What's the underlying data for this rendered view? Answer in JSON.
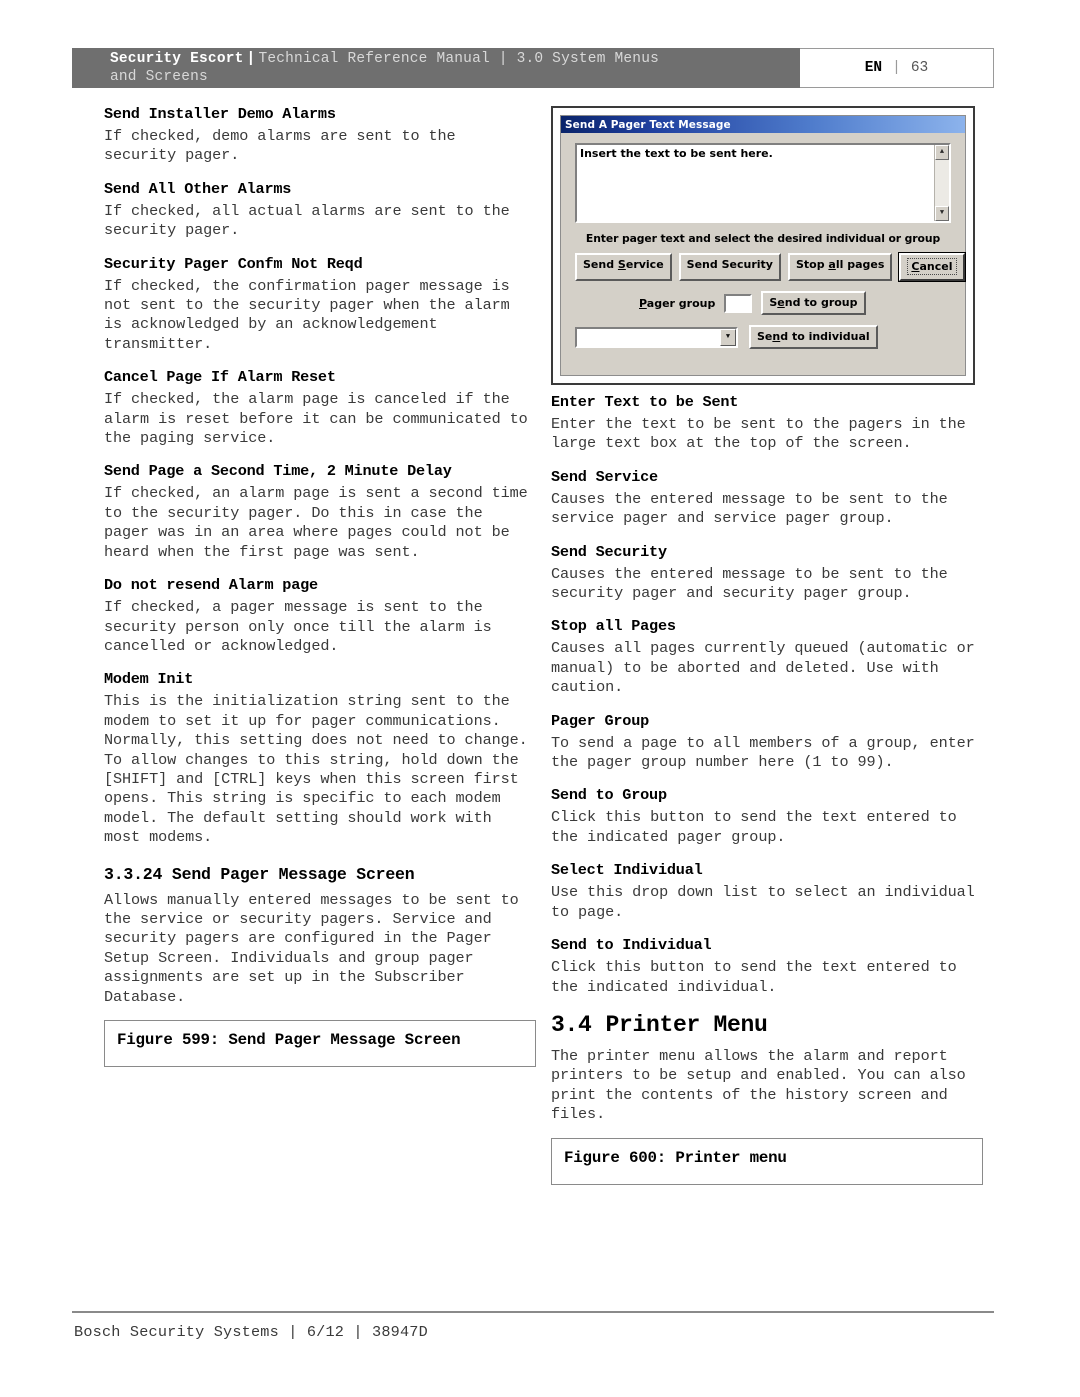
{
  "header": {
    "brand": "Security Escort",
    "sep": "|",
    "manual": "Technical Reference Manual",
    "section": "3.0  System Menus and Screens",
    "line1": "Technical Reference Manual | 3.0  System Menus",
    "line2": "and Screens",
    "language": "EN",
    "page_sep": "|",
    "page_number": "63"
  },
  "left_column": {
    "entries": [
      {
        "term": "Send Installer Demo Alarms",
        "body": "If checked, demo alarms are sent to the security pager."
      },
      {
        "term": "Send All Other Alarms",
        "body": "If checked, all actual alarms are sent to the security pager."
      },
      {
        "term": "Security Pager Confm Not Reqd",
        "body": "If checked, the confirmation pager message is not sent to the security pager when the alarm is acknowledged by an acknowledgement transmitter."
      },
      {
        "term": "Cancel Page If Alarm Reset",
        "body": "If checked, the alarm page is canceled if the alarm is reset before it can be communicated to the paging service."
      },
      {
        "term": "Send Page a Second Time, 2 Minute Delay",
        "body": "If checked, an alarm page is sent a second time to the security pager. Do this in case the pager was in an area where pages could not be heard when the first page was sent."
      },
      {
        "term": "Do not resend Alarm page",
        "body": "If checked, a pager message is sent to the security person only once till the alarm is cancelled or acknowledged."
      },
      {
        "term": "Modem Init",
        "body": "This is the initialization string sent to the modem to set it up for pager communications. Normally, this setting does not need to change. To allow changes to this string, hold down the [SHIFT] and [CTRL] keys when this screen first opens. This string is specific to each modem model. The default setting should work with most modems."
      }
    ],
    "section_heading": "3.3.24 Send Pager Message Screen",
    "section_body": "Allows manually entered messages to be sent to the service or security pagers. Service and security pagers are configured in the Pager Setup Screen. Individuals and group pager assignments are set up in the Subscriber Database.",
    "figure_caption": "Figure 599: Send Pager Message Screen"
  },
  "dialog": {
    "title": "Send A Pager Text Message",
    "message_text": "Insert the text to be sent here.",
    "hint": "Enter pager text and select the desired individual or group",
    "scroll_up_icon": "scroll-up-arrow",
    "scroll_down_icon": "scroll-down-arrow",
    "dropdown_icon": "chevron-down-icon",
    "buttons": {
      "send_service": "Send Service",
      "send_service_pre": "Send ",
      "send_service_mnemonic": "S",
      "send_service_post": "ervice",
      "send_security": "Send Security",
      "stop_all_pages_pre": "Stop ",
      "stop_all_pages_mnemonic": "a",
      "stop_all_pages_post": "ll pages",
      "stop_all_pages": "Stop all pages",
      "cancel": "Cancel",
      "cancel_pre": "",
      "cancel_mnemonic": "C",
      "cancel_post": "ancel",
      "send_to_group_pre": "S",
      "send_to_group_mnemonic": "e",
      "send_to_group_post": "nd to group",
      "send_to_group": "Send to group",
      "send_to_individual_pre": "Se",
      "send_to_individual_mnemonic": "n",
      "send_to_individual_post": "d to individual",
      "send_to_individual": "Send to individual"
    },
    "pager_group_label_pre": "",
    "pager_group_label_mnemonic": "P",
    "pager_group_label_post": "ager group",
    "pager_group_label": "Pager group",
    "pager_group_value": "",
    "individual_value": ""
  },
  "right_column": {
    "entries": [
      {
        "term": "Enter Text to be Sent",
        "body": "Enter the text to be sent to the pagers in the large text box at the top of the screen."
      },
      {
        "term": "Send Service",
        "body": "Causes the entered message to be sent to the service pager and service pager group."
      },
      {
        "term": "Send Security",
        "body": "Causes the entered message to be sent to the security pager and security pager group."
      },
      {
        "term": "Stop all Pages",
        "body": "Causes all pages currently queued (automatic or manual) to be aborted and deleted. Use with caution."
      },
      {
        "term": "Pager Group",
        "body": "To send a page to all members of a group, enter the pager group number here (1 to 99)."
      },
      {
        "term": "Send to Group",
        "body": "Click this button to send the text entered to the indicated pager group."
      },
      {
        "term": "Select Individual",
        "body": "Use this drop down list to select an individual to page."
      },
      {
        "term": "Send to Individual",
        "body": "Click this button to send the text entered to the indicated individual."
      }
    ],
    "section_number": "3.4",
    "section_title": "Printer Menu",
    "section_body": "The printer menu allows the alarm and report printers to be setup and enabled. You can also print the contents of the history screen and files.",
    "figure_caption": "Figure 600: Printer menu"
  },
  "footer": {
    "text": "Bosch Security Systems | 6/12 | 38947D"
  }
}
